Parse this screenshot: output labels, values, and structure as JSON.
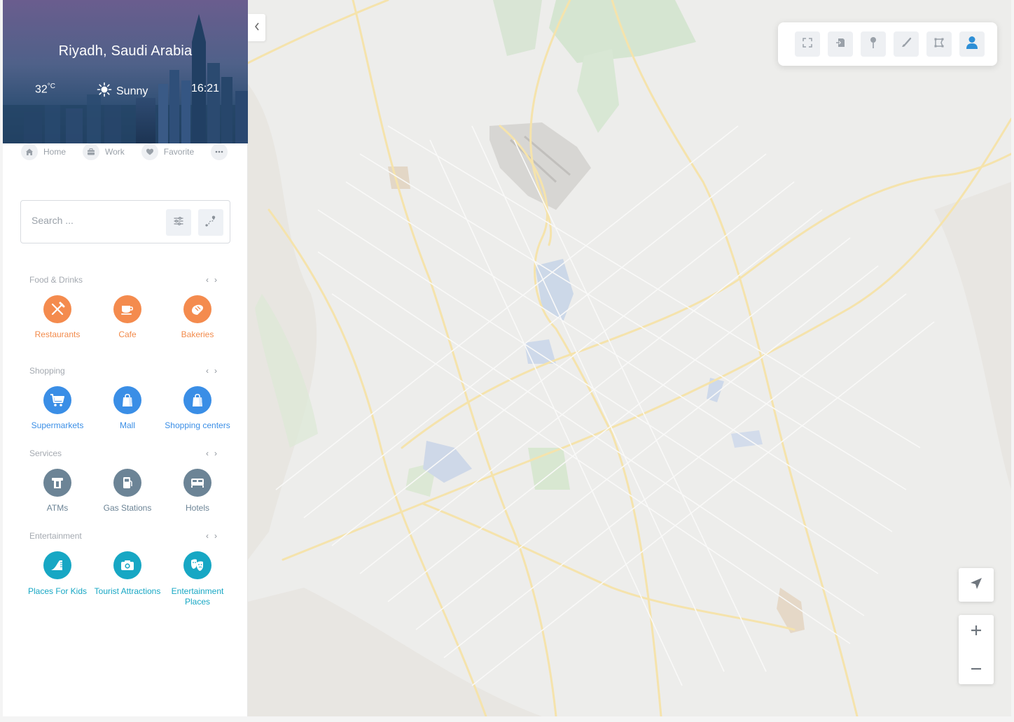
{
  "location": {
    "city": "Riyadh, Saudi Arabia",
    "temperature": "32",
    "temperature_unit": "°C",
    "condition": "Sunny",
    "time": "16:21"
  },
  "quick_links": [
    {
      "label": "Home",
      "icon": "home-icon"
    },
    {
      "label": "Work",
      "icon": "briefcase-icon"
    },
    {
      "label": "Favorite",
      "icon": "heart-icon"
    }
  ],
  "search": {
    "placeholder": "Search ..."
  },
  "categories": [
    {
      "title": "Food & Drinks",
      "color": "#f28a4a",
      "items": [
        {
          "label": "Restaurants",
          "icon": "fork-knife-icon"
        },
        {
          "label": "Cafe",
          "icon": "coffee-cup-icon"
        },
        {
          "label": "Bakeries",
          "icon": "bread-icon"
        }
      ]
    },
    {
      "title": "Shopping",
      "color": "#3a8ee6",
      "items": [
        {
          "label": "Supermarkets",
          "icon": "cart-icon"
        },
        {
          "label": "Mall",
          "icon": "shopping-bag-icon"
        },
        {
          "label": "Shopping centers",
          "icon": "shopping-bag-icon"
        }
      ]
    },
    {
      "title": "Services",
      "color": "#6c8496",
      "items": [
        {
          "label": "ATMs",
          "icon": "atm-icon"
        },
        {
          "label": "Gas Stations",
          "icon": "fuel-icon"
        },
        {
          "label": "Hotels",
          "icon": "bed-icon"
        }
      ]
    },
    {
      "title": "Entertainment",
      "color": "#17a7c4",
      "items": [
        {
          "label": "Places For Kids",
          "icon": "slide-icon"
        },
        {
          "label": "Tourist Attractions",
          "icon": "camera-icon"
        },
        {
          "label": "Entertainment Places",
          "icon": "theater-masks-icon"
        }
      ]
    }
  ],
  "toolbar": [
    "fullscreen-icon",
    "export-icon",
    "pin-icon",
    "brush-icon",
    "polygon-icon",
    "user-icon"
  ],
  "colors": {
    "accent_blue": "#3a8ee6",
    "user_icon": "#2e8fd6"
  }
}
